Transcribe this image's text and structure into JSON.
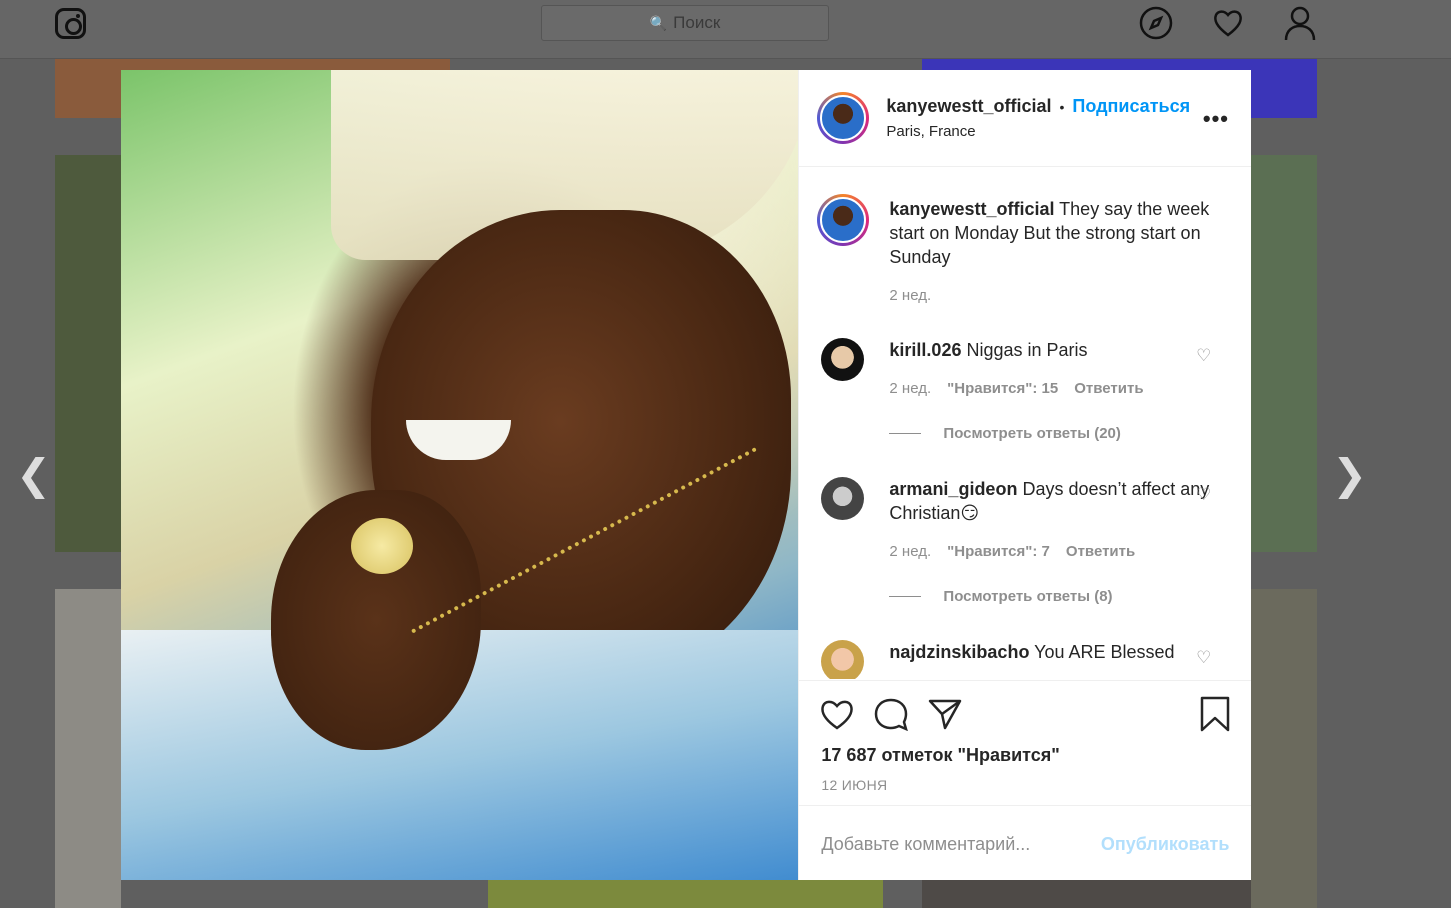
{
  "topbar": {
    "search_placeholder": "Поиск"
  },
  "post": {
    "username": "kanyewestt_official",
    "follow_label": "Подписаться",
    "location": "Paris, France",
    "caption": {
      "username": "kanyewestt_official",
      "text": "They say the week start on Monday But the strong start on Sunday",
      "time": "2 нед."
    },
    "comments": [
      {
        "username": "kirill.026",
        "text": "Niggas in Paris",
        "time": "2 нед.",
        "likes": "\"Нравится\": 15",
        "reply": "Ответить",
        "view_replies": "Посмотреть ответы (20)"
      },
      {
        "username": "armani_gideon",
        "text": "Days doesn’t affect any Christian😏",
        "time": "2 нед.",
        "likes": "\"Нравится\": 7",
        "reply": "Ответить",
        "view_replies": "Посмотреть ответы (8)"
      },
      {
        "username": "najdzinskibacho",
        "text": "You ARE Blessed"
      }
    ],
    "likes_count": "17 687 отметок \"Нравится\"",
    "date": "12 ИЮНЯ",
    "comment_placeholder": "Добавьте комментарий...",
    "publish_label": "Опубликовать"
  },
  "icons": [
    "instagram-logo",
    "search-icon",
    "explore-icon",
    "heart-icon",
    "profile-icon",
    "more-icon",
    "like-icon",
    "comment-icon",
    "share-icon",
    "bookmark-icon",
    "prev-arrow-icon",
    "next-arrow-icon"
  ]
}
